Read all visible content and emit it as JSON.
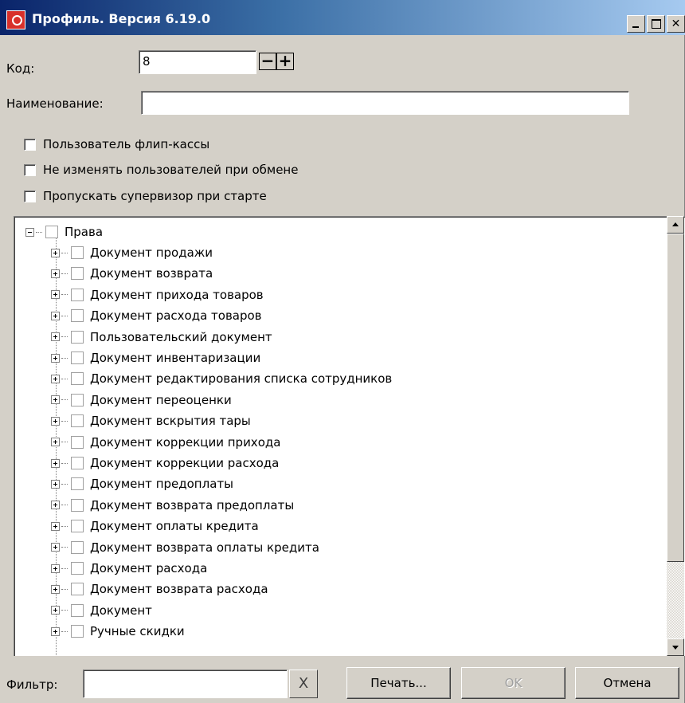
{
  "window": {
    "title": "Профиль. Версия 6.19.0",
    "buttons": [
      "minimize",
      "maximize",
      "close"
    ]
  },
  "form": {
    "code_label": "Код:",
    "code_value": "8",
    "code_decrement": "−",
    "code_increment": "+",
    "name_label": "Наименование:",
    "name_value": "",
    "checkboxes": [
      {
        "label": "Пользователь флип-кассы",
        "checked": false
      },
      {
        "label": "Не изменять пользователей при обмене",
        "checked": false
      },
      {
        "label": "Пропускать супервизор при старте",
        "checked": false
      }
    ]
  },
  "tree": {
    "root": {
      "label": "Права",
      "expanded": true,
      "checked": false
    },
    "items": [
      "Документ продажи",
      "Документ возврата",
      "Документ прихода товаров",
      "Документ расхода товаров",
      "Пользовательский документ",
      "Документ инвентаризации",
      "Документ редактирования списка сотрудников",
      "Документ переоценки",
      "Документ вскрытия тары",
      "Документ коррекции прихода",
      "Документ коррекции расхода",
      "Документ предоплаты",
      "Документ возврата предоплаты",
      "Документ оплаты кредита",
      "Документ возврата оплаты кредита",
      "Документ расхода",
      "Документ возврата расхода",
      "Документ",
      "Ручные скидки"
    ]
  },
  "bottom": {
    "filter_label": "Фильтр:",
    "filter_value": "",
    "clear_label": "X",
    "print_label": "Печать...",
    "ok_label": "OK",
    "cancel_label": "Отмена",
    "ok_enabled": false
  }
}
